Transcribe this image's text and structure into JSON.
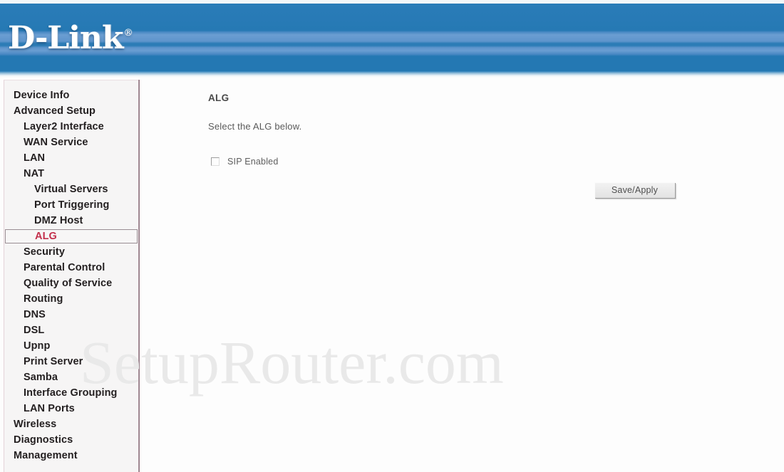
{
  "header": {
    "logo_text": "D-Link",
    "logo_registered_mark": "®",
    "accent_blue": "#2478b4",
    "band_blue": "#6b9ed2"
  },
  "sidebar": {
    "background": "#f6f5f5",
    "selected_color": "#c3304c",
    "items": [
      {
        "label": "Device Info",
        "level": 1,
        "selected": false
      },
      {
        "label": "Advanced Setup",
        "level": 1,
        "selected": false
      },
      {
        "label": "Layer2 Interface",
        "level": 2,
        "selected": false
      },
      {
        "label": "WAN Service",
        "level": 2,
        "selected": false
      },
      {
        "label": "LAN",
        "level": 2,
        "selected": false
      },
      {
        "label": "NAT",
        "level": 2,
        "selected": false
      },
      {
        "label": "Virtual Servers",
        "level": 3,
        "selected": false
      },
      {
        "label": "Port Triggering",
        "level": 3,
        "selected": false
      },
      {
        "label": "DMZ Host",
        "level": 3,
        "selected": false
      },
      {
        "label": "ALG",
        "level": 3,
        "selected": true
      },
      {
        "label": "Security",
        "level": 2,
        "selected": false
      },
      {
        "label": "Parental Control",
        "level": 2,
        "selected": false
      },
      {
        "label": "Quality of Service",
        "level": 2,
        "selected": false
      },
      {
        "label": "Routing",
        "level": 2,
        "selected": false
      },
      {
        "label": "DNS",
        "level": 2,
        "selected": false
      },
      {
        "label": "DSL",
        "level": 2,
        "selected": false
      },
      {
        "label": "Upnp",
        "level": 2,
        "selected": false
      },
      {
        "label": "Print Server",
        "level": 2,
        "selected": false
      },
      {
        "label": "Samba",
        "level": 2,
        "selected": false
      },
      {
        "label": "Interface Grouping",
        "level": 2,
        "selected": false
      },
      {
        "label": "LAN Ports",
        "level": 2,
        "selected": false
      },
      {
        "label": "Wireless",
        "level": 1,
        "selected": false
      },
      {
        "label": "Diagnostics",
        "level": 1,
        "selected": false
      },
      {
        "label": "Management",
        "level": 1,
        "selected": false
      }
    ]
  },
  "main": {
    "title": "ALG",
    "description": "Select the ALG below.",
    "checkbox": {
      "label": "SIP Enabled",
      "checked": false
    },
    "save_button_label": "Save/Apply"
  },
  "watermark": {
    "text": "SetupRouter.com"
  }
}
